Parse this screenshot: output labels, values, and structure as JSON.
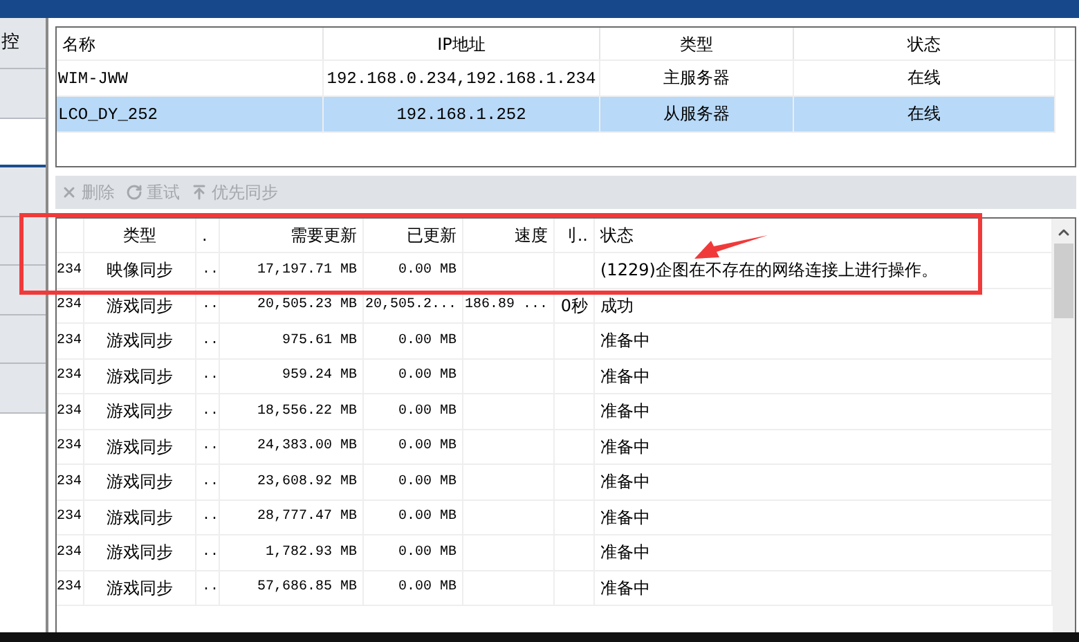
{
  "sidebar": {
    "tabs": [
      {
        "label": "控",
        "selected": false
      },
      {
        "selected": false
      },
      {
        "selected": true
      },
      {
        "selected": false
      },
      {
        "selected": false
      },
      {
        "selected": false
      },
      {
        "selected": false
      },
      {
        "selected": false
      }
    ]
  },
  "servers": {
    "columns": [
      "名称",
      "IP地址",
      "类型",
      "状态"
    ],
    "rows": [
      {
        "cells": [
          "WIM-JWW",
          "192.168.0.234,192.168.1.234",
          "主服务器",
          "在线"
        ],
        "selected": false
      },
      {
        "cells": [
          "LCO_DY_252",
          "192.168.1.252",
          "从服务器",
          "在线"
        ],
        "selected": true
      }
    ]
  },
  "toolbar": [
    {
      "kind": "delete",
      "label": "删除",
      "disabled": true
    },
    {
      "kind": "retry",
      "label": "重试",
      "disabled": true
    },
    {
      "kind": "priority",
      "label": "优先同步",
      "disabled": true
    }
  ],
  "tasks": {
    "columns": [
      "",
      "类型",
      ".",
      "需要更新",
      "已更新",
      "速度",
      "刂..",
      "状态"
    ],
    "rows": [
      {
        "cells": [
          "234",
          "映像同步",
          "..",
          "17,197.71 MB",
          "0.00 MB",
          "",
          "",
          "(1229)企图在不存在的网络连接上进行操作。"
        ]
      },
      {
        "cells": [
          "234",
          "游戏同步",
          "..",
          "20,505.23 MB",
          "20,505.2...",
          "186.89 ...",
          "0秒",
          "成功"
        ]
      },
      {
        "cells": [
          "234",
          "游戏同步",
          "..",
          "975.61 MB",
          "0.00 MB",
          "",
          "",
          "准备中"
        ]
      },
      {
        "cells": [
          "234",
          "游戏同步",
          "..",
          "959.24 MB",
          "0.00 MB",
          "",
          "",
          "准备中"
        ]
      },
      {
        "cells": [
          "234",
          "游戏同步",
          "..",
          "18,556.22 MB",
          "0.00 MB",
          "",
          "",
          "准备中"
        ]
      },
      {
        "cells": [
          "234",
          "游戏同步",
          "..",
          "24,383.00 MB",
          "0.00 MB",
          "",
          "",
          "准备中"
        ]
      },
      {
        "cells": [
          "234",
          "游戏同步",
          "..",
          "23,608.92 MB",
          "0.00 MB",
          "",
          "",
          "准备中"
        ]
      },
      {
        "cells": [
          "234",
          "游戏同步",
          "..",
          "28,777.47 MB",
          "0.00 MB",
          "",
          "",
          "准备中"
        ]
      },
      {
        "cells": [
          "234",
          "游戏同步",
          "..",
          "1,782.93 MB",
          "0.00 MB",
          "",
          "",
          "准备中"
        ]
      },
      {
        "cells": [
          "234",
          "游戏同步",
          "..",
          "57,686.85 MB",
          "0.00 MB",
          "",
          "",
          "准备中"
        ]
      }
    ]
  }
}
